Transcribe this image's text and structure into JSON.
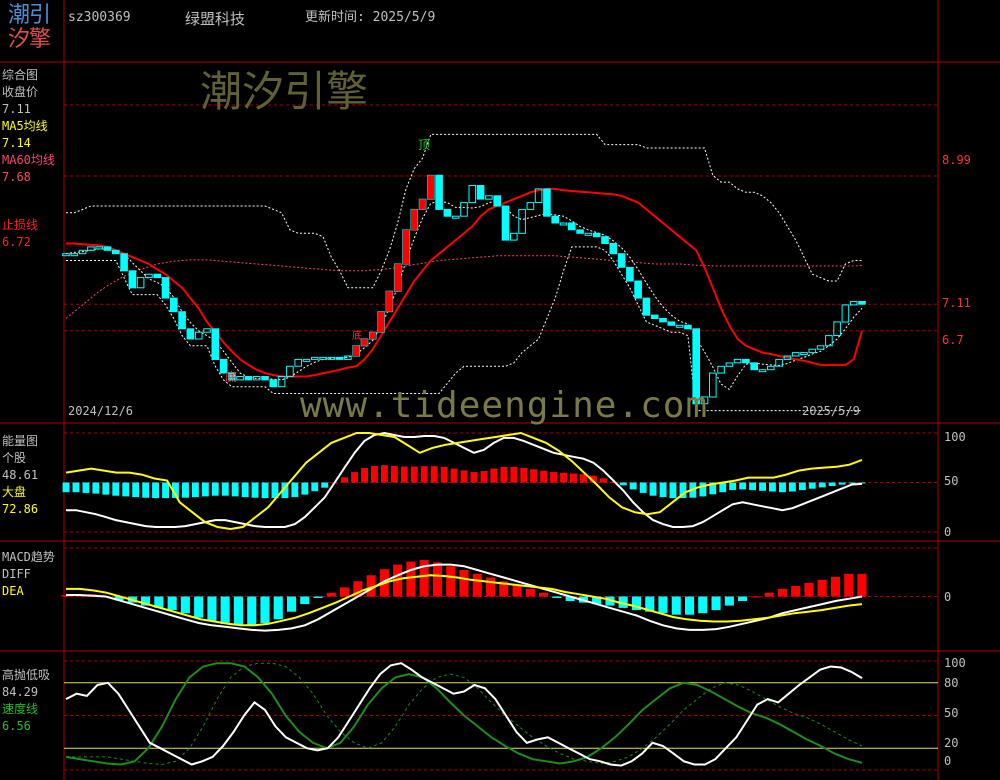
{
  "colors": {
    "background": "#000000",
    "frame": "#b00000",
    "up": "#ff0000",
    "down": "#00ffff",
    "white_line": "#ffffff",
    "yellow_line": "#ffff00",
    "ma60": "#ff4466",
    "green_line": "#1e8c1e"
  },
  "header": {
    "logo_line1": "潮引",
    "logo_line2": "汐擎",
    "code": "sz300369",
    "name": "绿盟科技",
    "update_label": "更新时间: 2025/5/9"
  },
  "watermarks": {
    "brand": "潮汐引擎",
    "url": "www.tideengine.com"
  },
  "panels": {
    "main": {
      "title": "综合图",
      "close_label": "收盘价",
      "close_value": "7.11",
      "ma5_label": "MA5均线",
      "ma5_value": "7.14",
      "ma60_label": "MA60均线",
      "ma60_value": "7.68",
      "stop_label": "止损线",
      "stop_value": "6.72",
      "right_labels": [
        "8.99",
        "7.11",
        "6.7"
      ],
      "top_marker": "顶",
      "bottom_marker": "底",
      "mid_marker": "底",
      "start_date": "2024/12/6",
      "end_date": "2025/5/9"
    },
    "energy": {
      "title": "能量图",
      "stock_label": "个股",
      "stock_value": "48.61",
      "market_label": "大盘",
      "market_value": "72.86",
      "ticks": [
        "100",
        "50",
        "0"
      ]
    },
    "macd": {
      "title": "MACD趋势",
      "diff_label": "DIFF",
      "dea_label": "DEA",
      "ticks": [
        "0"
      ]
    },
    "swing": {
      "title": "高抛低吸",
      "value": "84.29",
      "speed_label": "速度线",
      "speed_value": "6.56",
      "ticks": [
        "100",
        "80",
        "50",
        "20",
        "0"
      ]
    }
  },
  "chart_data": [
    {
      "type": "candlestick",
      "title": "综合图",
      "ylim": [
        5.5,
        10.5
      ],
      "x": [
        "2024/12/6",
        "2025/5/9"
      ],
      "closes": [
        7.85,
        7.85,
        7.9,
        7.95,
        7.95,
        7.9,
        7.85,
        7.6,
        7.35,
        7.5,
        7.55,
        7.5,
        7.2,
        7.0,
        6.75,
        6.6,
        6.7,
        6.75,
        6.3,
        6.1,
        6.0,
        6.05,
        6.0,
        6.05,
        6.0,
        5.9,
        6.05,
        6.2,
        6.3,
        6.3,
        6.33,
        6.33,
        6.33,
        6.3,
        6.35,
        6.5,
        6.6,
        6.7,
        7.0,
        7.3,
        7.7,
        8.2,
        8.5,
        8.65,
        9.0,
        8.5,
        8.4,
        8.4,
        8.6,
        8.85,
        8.65,
        8.7,
        8.55,
        8.05,
        8.15,
        8.5,
        8.6,
        8.8,
        8.4,
        8.3,
        8.3,
        8.2,
        8.15,
        8.15,
        8.1,
        8.0,
        7.85,
        7.65,
        7.45,
        7.2,
        6.95,
        6.9,
        6.85,
        6.8,
        6.8,
        6.75,
        5.65,
        5.75,
        6.1,
        6.2,
        6.25,
        6.3,
        6.25,
        6.15,
        6.15,
        6.2,
        6.3,
        6.35,
        6.4,
        6.4,
        6.45,
        6.5,
        6.65,
        6.85,
        7.1,
        7.15,
        7.11
      ],
      "ma5": [
        7.85,
        7.87,
        7.88,
        7.9,
        7.92,
        7.92,
        7.91,
        7.85,
        7.72,
        7.6,
        7.48,
        7.43,
        7.36,
        7.21,
        7.0,
        6.84,
        6.72,
        6.65,
        6.57,
        6.42,
        6.26,
        6.1,
        6.04,
        6.02,
        6.02,
        6.01,
        6.0,
        6.04,
        6.12,
        6.2,
        6.26,
        6.3,
        6.32,
        6.33,
        6.33,
        6.38,
        6.47,
        6.58,
        6.79,
        7.06,
        7.36,
        7.74,
        8.08,
        8.37,
        8.59,
        8.62,
        8.6,
        8.53,
        8.53,
        8.52,
        8.54,
        8.6,
        8.62,
        8.53,
        8.4,
        8.35,
        8.38,
        8.41,
        8.44,
        8.42,
        8.4,
        8.33,
        8.25,
        8.2,
        8.16,
        8.12,
        8.04,
        7.94,
        7.8,
        7.62,
        7.42,
        7.23,
        7.07,
        6.95,
        6.86,
        6.82,
        6.61,
        6.41,
        6.19,
        5.94,
        5.86,
        6.06,
        6.23,
        6.25,
        6.23,
        6.22,
        6.21,
        6.24,
        6.29,
        6.33,
        6.38,
        6.42,
        6.5,
        6.6,
        6.75,
        6.92,
        7.05
      ],
      "ma60": [
        6.9,
        7.0,
        7.1,
        7.2,
        7.3,
        7.38,
        7.45,
        7.52,
        7.57,
        7.62,
        7.66,
        7.7,
        7.72,
        7.74,
        7.75,
        7.76,
        7.76,
        7.76,
        7.75,
        7.74,
        7.73,
        7.72,
        7.71,
        7.7,
        7.69,
        7.68,
        7.67,
        7.66,
        7.65,
        7.64,
        7.63,
        7.62,
        7.61,
        7.6,
        7.6,
        7.6,
        7.6,
        7.61,
        7.62,
        7.63,
        7.65,
        7.67,
        7.69,
        7.71,
        7.73,
        7.75,
        7.76,
        7.77,
        7.78,
        7.79,
        7.8,
        7.81,
        7.82,
        7.82,
        7.82,
        7.82,
        7.82,
        7.82,
        7.82,
        7.82,
        7.81,
        7.8,
        7.79,
        7.78,
        7.77,
        7.76,
        7.75,
        7.74,
        7.73,
        7.72,
        7.71,
        7.7,
        7.7,
        7.7,
        7.7,
        7.69,
        7.68,
        7.68,
        7.67,
        7.67,
        7.67,
        7.67,
        7.67,
        7.67,
        7.67,
        7.67,
        7.67,
        7.67,
        7.67,
        7.67,
        7.67,
        7.67,
        7.67,
        7.67,
        7.67,
        7.67,
        7.68
      ],
      "stop_line": [
        8.0,
        8.0,
        7.99,
        7.98,
        7.97,
        7.95,
        7.9,
        7.85,
        7.8,
        7.75,
        7.7,
        7.62,
        7.55,
        7.45,
        7.35,
        7.2,
        7.05,
        6.85,
        6.7,
        6.55,
        6.42,
        6.3,
        6.22,
        6.15,
        6.1,
        6.07,
        6.05,
        6.05,
        6.05,
        6.05,
        6.07,
        6.1,
        6.12,
        6.15,
        6.18,
        6.2,
        6.3,
        6.45,
        6.65,
        6.85,
        7.05,
        7.25,
        7.45,
        7.6,
        7.75,
        7.85,
        7.95,
        8.05,
        8.15,
        8.25,
        8.4,
        8.5,
        8.55,
        8.6,
        8.65,
        8.7,
        8.75,
        8.78,
        8.8,
        8.8,
        8.78,
        8.77,
        8.76,
        8.75,
        8.74,
        8.73,
        8.72,
        8.7,
        8.65,
        8.6,
        8.5,
        8.4,
        8.3,
        8.2,
        8.1,
        8.0,
        7.9,
        7.65,
        7.35,
        7.05,
        6.8,
        6.6,
        6.5,
        6.45,
        6.4,
        6.38,
        6.35,
        6.33,
        6.3,
        6.28,
        6.25,
        6.22,
        6.22,
        6.22,
        6.22,
        6.3,
        6.72
      ]
    },
    {
      "type": "line",
      "title": "能量图",
      "ylim": [
        0,
        100
      ],
      "series": [
        {
          "name": "个股",
          "values": [
            22,
            22,
            20,
            18,
            15,
            12,
            10,
            8,
            6,
            5,
            5,
            5,
            6,
            8,
            10,
            12,
            12,
            10,
            8,
            6,
            5,
            5,
            5,
            8,
            15,
            25,
            35,
            50,
            65,
            80,
            92,
            98,
            100,
            98,
            96,
            96,
            97,
            97,
            95,
            90,
            85,
            80,
            83,
            90,
            95,
            95,
            92,
            88,
            84,
            80,
            78,
            76,
            74,
            70,
            62,
            52,
            42,
            30,
            20,
            12,
            8,
            5,
            5,
            6,
            10,
            16,
            22,
            28,
            30,
            28,
            26,
            24,
            22,
            24,
            28,
            32,
            36,
            40,
            44,
            48,
            48.61
          ]
        },
        {
          "name": "大盘",
          "values": [
            60,
            62,
            64,
            62,
            60,
            60,
            58,
            54,
            52,
            30,
            20,
            10,
            5,
            3,
            5,
            15,
            25,
            40,
            55,
            70,
            80,
            90,
            95,
            100,
            100,
            98,
            96,
            88,
            80,
            85,
            88,
            90,
            92,
            94,
            96,
            98,
            100,
            95,
            90,
            82,
            72,
            60,
            48,
            35,
            25,
            20,
            18,
            20,
            30,
            40,
            45,
            48,
            50,
            52,
            55,
            55,
            55,
            58,
            62,
            64,
            65,
            66,
            68,
            72.86
          ]
        }
      ]
    },
    {
      "type": "bar+line",
      "title": "MACD趋势",
      "ylim": [
        -0.6,
        0.6
      ],
      "series": [
        {
          "name": "DIFF",
          "values": [
            0.02,
            0.02,
            0.01,
            0.0,
            -0.05,
            -0.1,
            -0.15,
            -0.2,
            -0.25,
            -0.3,
            -0.35,
            -0.38,
            -0.4,
            -0.42,
            -0.44,
            -0.45,
            -0.44,
            -0.42,
            -0.38,
            -0.3,
            -0.2,
            -0.1,
            0.0,
            0.1,
            0.2,
            0.28,
            0.35,
            0.4,
            0.42,
            0.42,
            0.4,
            0.35,
            0.3,
            0.25,
            0.2,
            0.15,
            0.1,
            0.05,
            0.0,
            -0.05,
            -0.1,
            -0.15,
            -0.2,
            -0.25,
            -0.32,
            -0.38,
            -0.42,
            -0.44,
            -0.44,
            -0.43,
            -0.4,
            -0.36,
            -0.32,
            -0.28,
            -0.22,
            -0.18,
            -0.14,
            -0.1,
            -0.06,
            -0.03,
            0.0
          ]
        },
        {
          "name": "DEA",
          "values": [
            0.1,
            0.1,
            0.08,
            0.05,
            0.0,
            -0.05,
            -0.1,
            -0.15,
            -0.2,
            -0.25,
            -0.3,
            -0.33,
            -0.36,
            -0.38,
            -0.38,
            -0.36,
            -0.32,
            -0.28,
            -0.22,
            -0.15,
            -0.08,
            0.0,
            0.08,
            0.14,
            0.2,
            0.24,
            0.26,
            0.28,
            0.27,
            0.25,
            0.22,
            0.2,
            0.18,
            0.16,
            0.14,
            0.12,
            0.1,
            0.06,
            0.03,
            0.0,
            -0.03,
            -0.08,
            -0.12,
            -0.17,
            -0.22,
            -0.27,
            -0.3,
            -0.32,
            -0.33,
            -0.33,
            -0.32,
            -0.3,
            -0.28,
            -0.25,
            -0.22,
            -0.2,
            -0.18,
            -0.15,
            -0.12,
            -0.1
          ]
        },
        {
          "name": "MACD",
          "values": [
            0.02,
            0.02,
            0.03,
            0.0,
            -0.05,
            -0.08,
            -0.12,
            -0.15,
            -0.18,
            -0.22,
            -0.28,
            -0.32,
            -0.36,
            -0.38,
            -0.38,
            -0.35,
            -0.3,
            -0.2,
            -0.1,
            -0.02,
            0.05,
            0.12,
            0.2,
            0.28,
            0.36,
            0.42,
            0.46,
            0.48,
            0.45,
            0.4,
            0.35,
            0.3,
            0.25,
            0.2,
            0.15,
            0.1,
            0.05,
            -0.02,
            -0.06,
            -0.08,
            -0.1,
            -0.12,
            -0.15,
            -0.18,
            -0.2,
            -0.22,
            -0.24,
            -0.24,
            -0.22,
            -0.18,
            -0.12,
            -0.06,
            0.0,
            0.05,
            0.1,
            0.14,
            0.18,
            0.22,
            0.26,
            0.3,
            0.3
          ]
        }
      ]
    },
    {
      "type": "line",
      "title": "高抛低吸",
      "ylim": [
        0,
        100
      ],
      "series": [
        {
          "name": "高抛低吸",
          "values": [
            65,
            70,
            68,
            78,
            80,
            70,
            55,
            40,
            25,
            20,
            15,
            10,
            5,
            8,
            12,
            22,
            35,
            50,
            62,
            55,
            40,
            30,
            25,
            20,
            18,
            20,
            30,
            45,
            60,
            75,
            88,
            96,
            98,
            92,
            85,
            80,
            75,
            70,
            72,
            78,
            75,
            65,
            50,
            35,
            25,
            28,
            30,
            25,
            20,
            15,
            10,
            8,
            5,
            4,
            8,
            15,
            25,
            22,
            15,
            8,
            5,
            5,
            10,
            20,
            30,
            45,
            60,
            65,
            62,
            70,
            78,
            85,
            92,
            95,
            94,
            90,
            84.29
          ]
        },
        {
          "name": "速度线",
          "values": [
            12,
            10,
            8,
            6,
            5,
            8,
            20,
            40,
            65,
            85,
            95,
            98,
            98,
            95,
            85,
            70,
            50,
            35,
            25,
            20,
            25,
            40,
            60,
            75,
            85,
            88,
            85,
            75,
            62,
            50,
            40,
            30,
            22,
            15,
            10,
            8,
            6,
            8,
            12,
            20,
            30,
            42,
            55,
            65,
            75,
            80,
            78,
            72,
            65,
            58,
            52,
            48,
            42,
            35,
            28,
            22,
            15,
            10,
            6.56
          ]
        }
      ]
    }
  ]
}
